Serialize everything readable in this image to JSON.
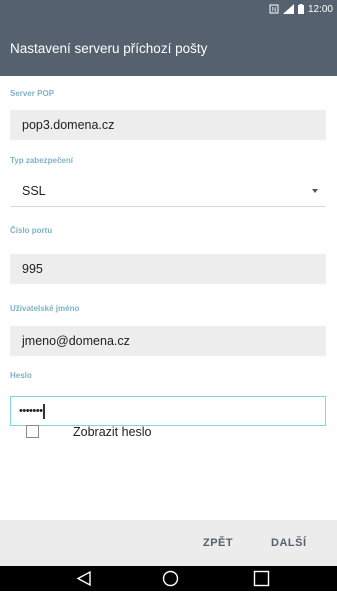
{
  "status_bar": {
    "time": "12:00",
    "icons": [
      "nfc-icon",
      "signal-icon",
      "battery-icon"
    ]
  },
  "header": {
    "title": "Nastavení serveru příchozí pošty"
  },
  "form": {
    "server": {
      "label": "Server POP",
      "value": "pop3.domena.cz"
    },
    "security": {
      "label": "Typ zabezpečení",
      "value": "SSL"
    },
    "port": {
      "label": "Číslo portu",
      "value": "995"
    },
    "username": {
      "label": "Uživatelské jméno",
      "value": "jmeno@domena.cz"
    },
    "password": {
      "label": "Heslo",
      "value": "•••••••"
    },
    "show_password": {
      "label": "Zobrazit heslo",
      "checked": false
    }
  },
  "actions": {
    "back_label": "ZPĚT",
    "next_label": "DALŠÍ"
  },
  "nav": {
    "icons": [
      "back-triangle-icon",
      "home-circle-icon",
      "recents-square-icon"
    ]
  },
  "colors": {
    "app_bar": "#55616f",
    "label": "#7eb3c7",
    "focus_border": "#84d4e0",
    "field_bg": "#ededed",
    "bottom_bar": "#ececec",
    "nav_bar": "#000000"
  }
}
